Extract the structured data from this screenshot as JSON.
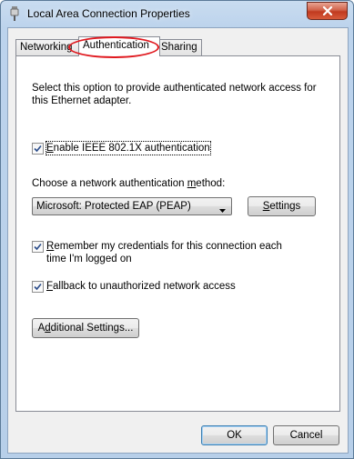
{
  "window": {
    "title": "Local Area Connection Properties",
    "close_icon": "close-icon",
    "app_icon": "network-connector-icon"
  },
  "tabs": [
    {
      "label": "Networking",
      "active": false
    },
    {
      "label": "Authentication",
      "active": true
    },
    {
      "label": "Sharing",
      "active": false
    }
  ],
  "annotation": {
    "highlight_color": "#e0191f"
  },
  "auth": {
    "description": "Select this option to provide authenticated network access for this Ethernet adapter.",
    "enable_8021x": {
      "label_prefix": "E",
      "label_rest": "nable IEEE 802.1X authentication",
      "checked": true
    },
    "method_label_prefix": "Choose a network authentication ",
    "method_label_accel": "m",
    "method_label_suffix": "ethod:",
    "method_selected": "Microsoft: Protected EAP (PEAP)",
    "settings_button": {
      "prefix": "",
      "accel": "S",
      "rest": "ettings"
    },
    "remember": {
      "accel": "R",
      "rest_line1": "emember my credentials for this connection each",
      "line2": "time I'm logged on",
      "checked": true
    },
    "fallback": {
      "accel": "F",
      "rest": "allback to unauthorized network access",
      "checked": true
    },
    "additional_button": {
      "prefix": "A",
      "accel": "d",
      "rest": "ditional Settings..."
    }
  },
  "footer": {
    "ok": "OK",
    "cancel": "Cancel"
  }
}
